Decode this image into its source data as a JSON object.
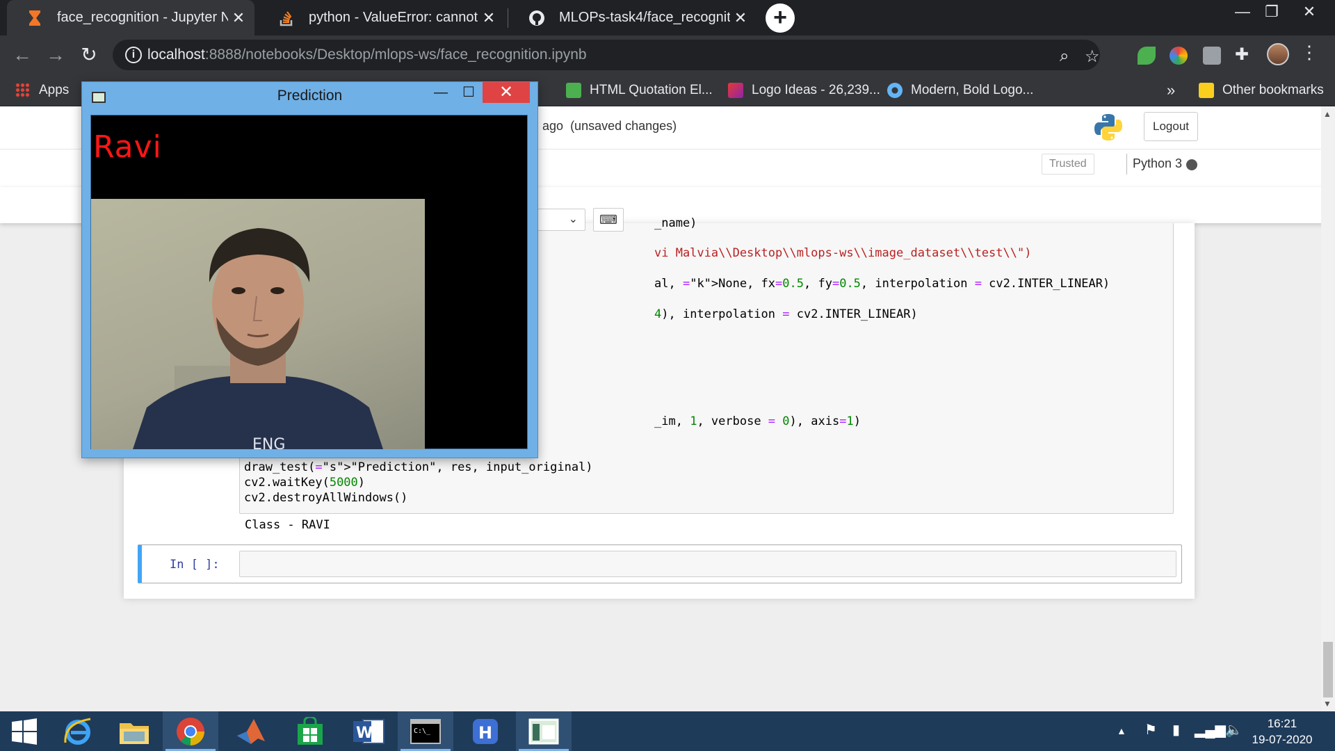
{
  "browser": {
    "tabs": [
      {
        "title": "face_recognition - Jupyter Notebook",
        "close": "✕"
      },
      {
        "title": "python - ValueError: cannot reshape",
        "close": "✕"
      },
      {
        "title": "MLOPs-task4/face_recognition.ipynb",
        "close": "✕"
      }
    ],
    "new_tab": "+",
    "url_host": "localhost",
    "url_path": ":8888/notebooks/Desktop/mlops-ws/face_recognition.ipynb",
    "bookmarks": [
      {
        "label": "Apps"
      },
      {
        "label": "HTML Quotation El..."
      },
      {
        "label": "Logo Ideas - 26,239..."
      },
      {
        "label": "Modern, Bold Logo..."
      }
    ],
    "more_bookmarks": "»",
    "other_bookmarks": "Other bookmarks"
  },
  "jupyter": {
    "save_status": "ago",
    "unsaved": "(unsaved changes)",
    "logout": "Logout",
    "trusted": "Trusted",
    "kernel": "Python 3",
    "keyboard_icon": "⌨",
    "code_lines": [
      "_name)",
      "vi Malvia\\\\Desktop\\\\mlops-ws\\\\image_dataset\\\\test\\\\\")",
      "al, None, fx=0.5, fy=0.5, interpolation = cv2.INTER_LINEAR)",
      "4), interpolation = cv2.INTER_LINEAR)",
      "_im, 1, verbose = 0), axis=1)",
      "draw_test(\"Prediction\", res, input_original)",
      "cv2.waitKey(5000)",
      "cv2.destroyAllWindows()"
    ],
    "output": "Class - RAVI",
    "new_prompt": "In [ ]:"
  },
  "prediction_window": {
    "title": "Prediction",
    "label": "Ravi"
  },
  "taskbar": {
    "time": "16:21",
    "date": "19-07-2020"
  }
}
